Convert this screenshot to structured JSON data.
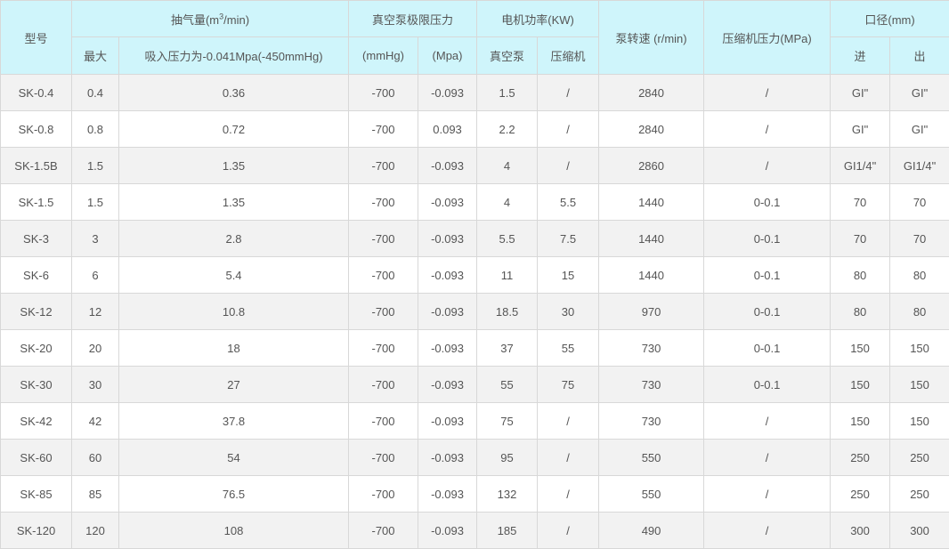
{
  "header": {
    "model": "型号",
    "flow_prefix": "抽气量(m",
    "flow_sup": "3",
    "flow_suffix": "/min)",
    "flow_max": "最大",
    "flow_suction": "吸入压力为-0.041Mpa(-450mmHg)",
    "vacuum_limit": "真空泵极限压力",
    "vacuum_mmhg": "(mmHg)",
    "vacuum_mpa": "(Mpa)",
    "motor_power": "电机功率(KW)",
    "motor_vacuum_pump": "真空泵",
    "motor_compressor": "压缩机",
    "pump_speed": "泵转速 (r/min)",
    "compressor_pressure": "压缩机压力(MPa)",
    "diameter": "口径(mm)",
    "diameter_in": "进",
    "diameter_out": "出"
  },
  "rows": [
    [
      "SK-0.4",
      "0.4",
      "0.36",
      "-700",
      "-0.093",
      "1.5",
      "/",
      "2840",
      "/",
      "GI\"",
      "GI\""
    ],
    [
      "SK-0.8",
      "0.8",
      "0.72",
      "-700",
      "0.093",
      "2.2",
      "/",
      "2840",
      "/",
      "GI\"",
      "GI\""
    ],
    [
      "SK-1.5B",
      "1.5",
      "1.35",
      "-700",
      "-0.093",
      "4",
      "/",
      "2860",
      "/",
      "GI1/4\"",
      "GI1/4\""
    ],
    [
      "SK-1.5",
      "1.5",
      "1.35",
      "-700",
      "-0.093",
      "4",
      "5.5",
      "1440",
      "0-0.1",
      "70",
      "70"
    ],
    [
      "SK-3",
      "3",
      "2.8",
      "-700",
      "-0.093",
      "5.5",
      "7.5",
      "1440",
      "0-0.1",
      "70",
      "70"
    ],
    [
      "SK-6",
      "6",
      "5.4",
      "-700",
      "-0.093",
      "11",
      "15",
      "1440",
      "0-0.1",
      "80",
      "80"
    ],
    [
      "SK-12",
      "12",
      "10.8",
      "-700",
      "-0.093",
      "18.5",
      "30",
      "970",
      "0-0.1",
      "80",
      "80"
    ],
    [
      "SK-20",
      "20",
      "18",
      "-700",
      "-0.093",
      "37",
      "55",
      "730",
      "0-0.1",
      "150",
      "150"
    ],
    [
      "SK-30",
      "30",
      "27",
      "-700",
      "-0.093",
      "55",
      "75",
      "730",
      "0-0.1",
      "150",
      "150"
    ],
    [
      "SK-42",
      "42",
      "37.8",
      "-700",
      "-0.093",
      "75",
      "/",
      "730",
      "/",
      "150",
      "150"
    ],
    [
      "SK-60",
      "60",
      "54",
      "-700",
      "-0.093",
      "95",
      "/",
      "550",
      "/",
      "250",
      "250"
    ],
    [
      "SK-85",
      "85",
      "76.5",
      "-700",
      "-0.093",
      "132",
      "/",
      "550",
      "/",
      "250",
      "250"
    ],
    [
      "SK-120",
      "120",
      "108",
      "-700",
      "-0.093",
      "185",
      "/",
      "490",
      "/",
      "300",
      "300"
    ]
  ]
}
